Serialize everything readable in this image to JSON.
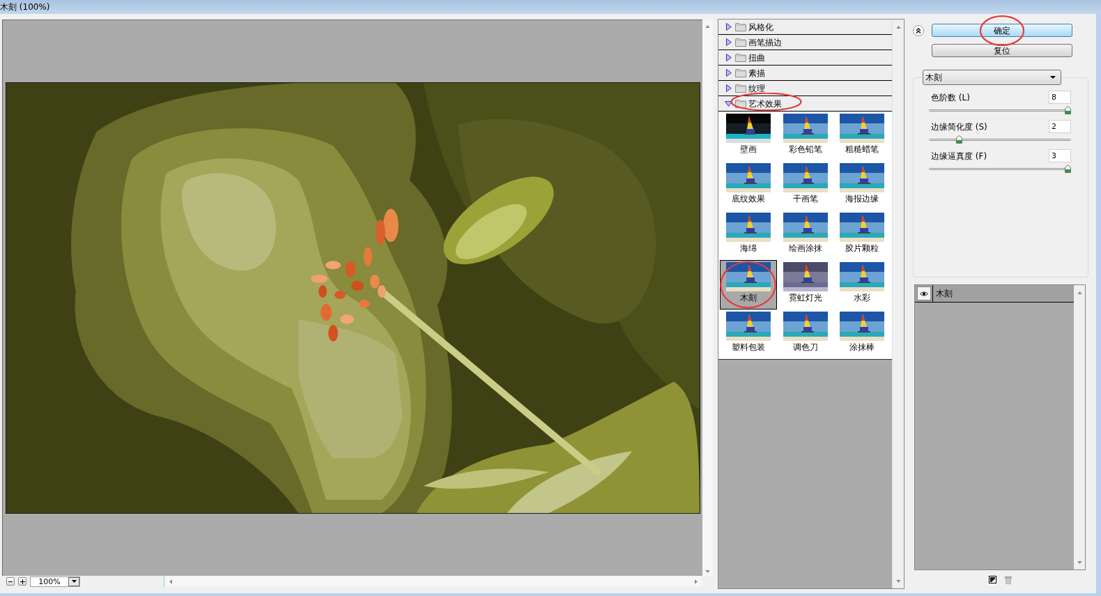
{
  "window": {
    "title": "木刻 (100%)"
  },
  "preview": {
    "zoom": "100%"
  },
  "filter_tree": {
    "categories": [
      {
        "label": "风格化",
        "expanded": false,
        "circled": false
      },
      {
        "label": "画笔描边",
        "expanded": false,
        "circled": false
      },
      {
        "label": "扭曲",
        "expanded": false,
        "circled": false
      },
      {
        "label": "素描",
        "expanded": false,
        "circled": false
      },
      {
        "label": "纹理",
        "expanded": false,
        "circled": false
      },
      {
        "label": "艺术效果",
        "expanded": true,
        "circled": true,
        "filters": [
          {
            "label": "壁画",
            "selected": false,
            "circled": false
          },
          {
            "label": "彩色铅笔",
            "selected": false,
            "circled": false
          },
          {
            "label": "粗糙蜡笔",
            "selected": false,
            "circled": false
          },
          {
            "label": "底纹效果",
            "selected": false,
            "circled": false
          },
          {
            "label": "干画笔",
            "selected": false,
            "circled": false
          },
          {
            "label": "海报边缘",
            "selected": false,
            "circled": false
          },
          {
            "label": "海绵",
            "selected": false,
            "circled": false
          },
          {
            "label": "绘画涂抹",
            "selected": false,
            "circled": false
          },
          {
            "label": "胶片颗粒",
            "selected": false,
            "circled": false
          },
          {
            "label": "木刻",
            "selected": true,
            "circled": true
          },
          {
            "label": "霓虹灯光",
            "selected": false,
            "circled": false
          },
          {
            "label": "水彩",
            "selected": false,
            "circled": false
          },
          {
            "label": "塑料包装",
            "selected": false,
            "circled": false
          },
          {
            "label": "调色刀",
            "selected": false,
            "circled": false
          },
          {
            "label": "涂抹棒",
            "selected": false,
            "circled": false
          }
        ]
      }
    ]
  },
  "dialog_buttons": [
    {
      "label": "确定",
      "kind": "default",
      "circled": true
    },
    {
      "label": "复位",
      "kind": "normal",
      "circled": false
    }
  ],
  "settings": {
    "filter": "木刻",
    "params": [
      {
        "label": "色阶数 (L)",
        "value": "8",
        "level": 1
      },
      {
        "label": "边缘简化度 (S)",
        "value": "2",
        "level": 0.2
      },
      {
        "label": "边缘逼真度 (F)",
        "value": "3",
        "level": 1
      }
    ]
  },
  "effect_layers": [
    {
      "label": "木刻",
      "visible": true
    }
  ]
}
